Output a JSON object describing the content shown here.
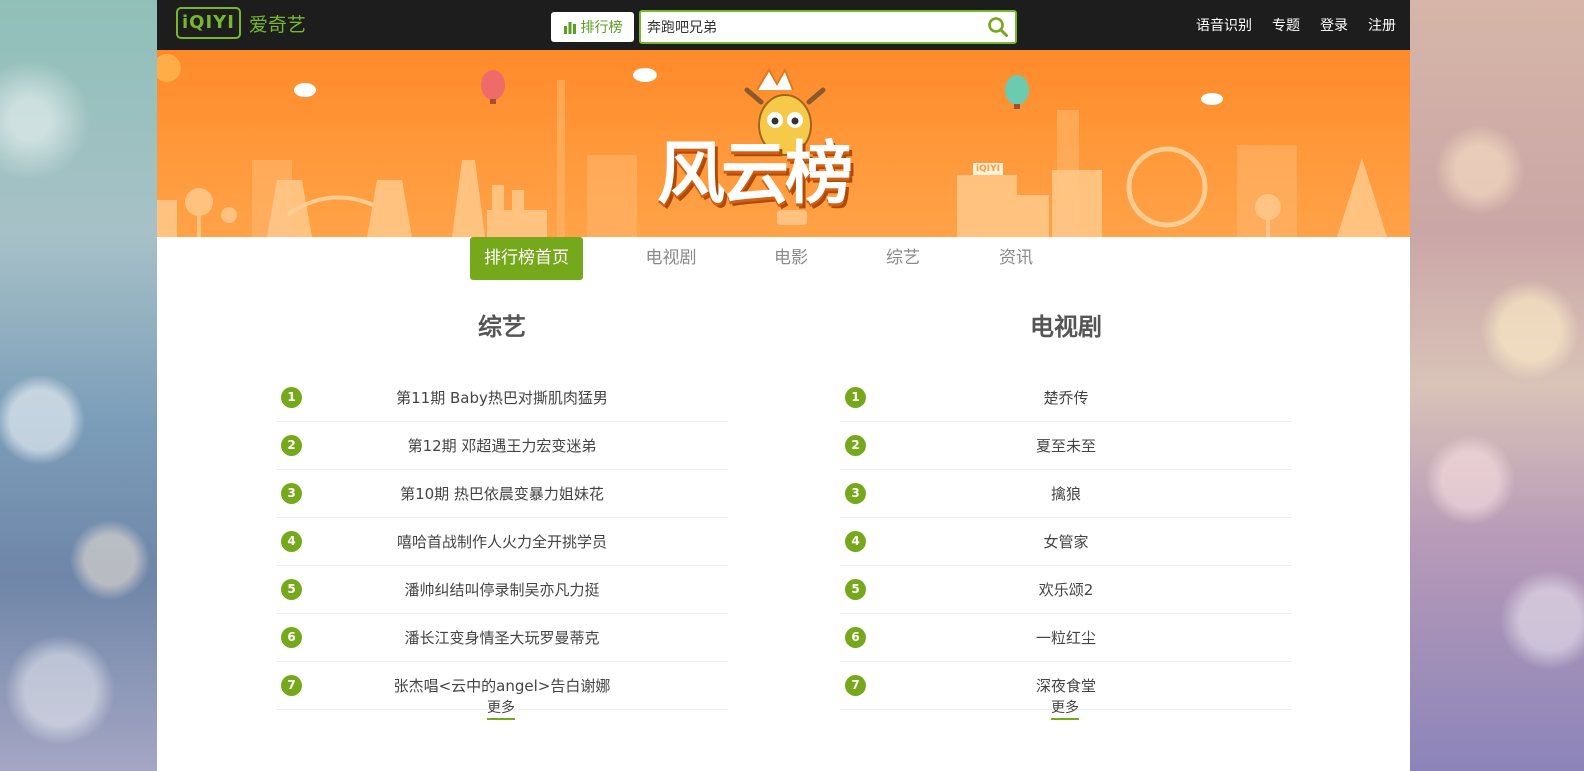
{
  "header": {
    "logo_box": "iQIYI",
    "logo_text": "爱奇艺",
    "rank_label": "排行榜",
    "search_value": "奔跑吧兄弟",
    "links": [
      "语音识别",
      "专题",
      "登录",
      "注册"
    ]
  },
  "banner": {
    "title": "风云榜",
    "badge": "iQIYI"
  },
  "nav": {
    "items": [
      "排行榜首页",
      "电视剧",
      "电影",
      "综艺",
      "资讯"
    ],
    "active": "排行榜首页"
  },
  "variety": {
    "title": "综艺",
    "items": [
      {
        "rank": "1",
        "title": "第11期 Baby热巴对撕肌肉猛男"
      },
      {
        "rank": "2",
        "title": "第12期 邓超遇王力宏变迷弟"
      },
      {
        "rank": "3",
        "title": "第10期 热巴依晨变暴力姐妹花"
      },
      {
        "rank": "4",
        "title": "嘻哈首战制作人火力全开挑学员"
      },
      {
        "rank": "5",
        "title": "潘帅纠结叫停录制吴亦凡力挺"
      },
      {
        "rank": "6",
        "title": "潘长江变身情圣大玩罗曼蒂克"
      },
      {
        "rank": "7",
        "title": "张杰唱<云中的angel>告白谢娜"
      }
    ],
    "more": "更多"
  },
  "tv": {
    "title": "电视剧",
    "items": [
      {
        "rank": "1",
        "title": "楚乔传"
      },
      {
        "rank": "2",
        "title": "夏至未至"
      },
      {
        "rank": "3",
        "title": "擒狼"
      },
      {
        "rank": "4",
        "title": "女管家"
      },
      {
        "rank": "5",
        "title": "欢乐颂2"
      },
      {
        "rank": "6",
        "title": "一粒红尘"
      },
      {
        "rank": "7",
        "title": "深夜食堂"
      }
    ],
    "more": "更多"
  },
  "colors": {
    "accent": "#76a81c",
    "banner": "#ff8a2a",
    "topbar": "#1d1d1d"
  }
}
